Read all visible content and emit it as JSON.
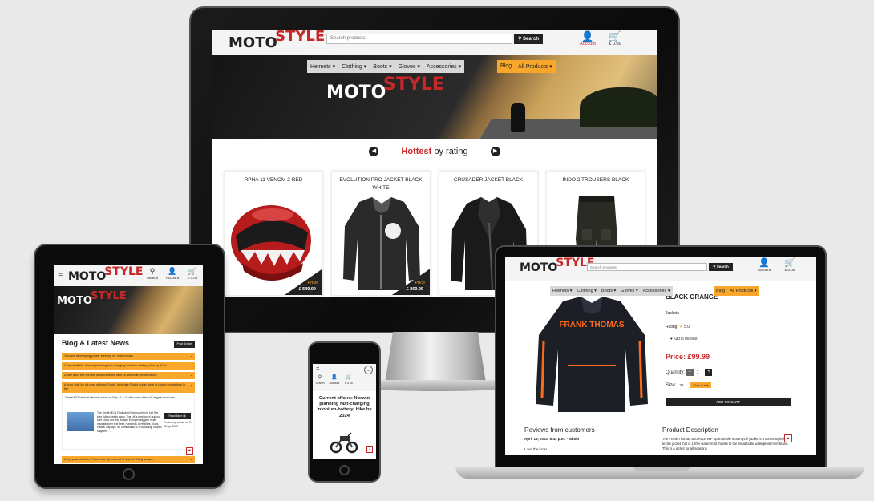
{
  "brand": {
    "moto": "MOTO",
    "style": "STYLE"
  },
  "monitor": {
    "search_placeholder": "Search products",
    "search_button": "Search",
    "account_label": "Account",
    "cart_total": "£ 0.00",
    "nav": [
      "Helmets ▾",
      "Clothing ▾",
      "Boots ▾",
      "Gloves ▾",
      "Accessories ▾"
    ],
    "nav_orange": [
      "Blog",
      "All Products ▾"
    ],
    "hottest_word": "Hottest",
    "hottest_rest": " by rating",
    "products": [
      {
        "name": "RPHA 11 VENOM 2 RED",
        "price_label": "Price",
        "price": "£ 549.99"
      },
      {
        "name": "EVOLUTION PRO JACKET BLACK WHITE",
        "price_label": "Price",
        "price": "£ 269.99"
      },
      {
        "name": "CRUSADER JACKET BLACK",
        "price_label": "",
        "price": ""
      },
      {
        "name": "INDO 2 TROUSERS BLACK",
        "price_label": "",
        "price": ""
      }
    ]
  },
  "tablet": {
    "search_label": "Search",
    "account_label": "Account",
    "cart_total": "£ 0.00",
    "blog_title": "Blog & Latest News",
    "post_button": "Post Article",
    "news": [
      "Yamaha developing power steering for motorcycles",
      "Current affairs: Norwin planning fast-charging 'niobium-battery' bike by 2024",
      "Dollar ditch the chrome to become the face of American performance",
      "A busy shift for off-road officers: South Yorkshire Police out in force to tackle motorbikes in the",
      "Keep yourself safe: Police offer tips ahead of start of riding season"
    ],
    "expanded_lead": "Desert MCN festival files into action on May 14 & 15 with some of the UK biggest stunt acts",
    "expanded_text": "The Devitt MCN Festival of Motorcycling is just five bike riding weeks away. The UK's best loved outdoor bike show not only boasts Europe's biggest multi-manufacturer test fleet, hundreds of retailers, clubs, classic displays; an unmissable, DTRA racing, Moped Mayhem ...",
    "read_more": "Read More ▤",
    "posted_meta": "Posted by: admin on Fri 22 Apr 2022"
  },
  "phone": {
    "search_label": "Search",
    "account_label": "Account",
    "cart_total": "£ 0.00",
    "article_title": "Current affairs: Norwin planning fast-charging 'niobium-battery' bike by 2024"
  },
  "laptop": {
    "search_placeholder": "Search products",
    "search_button": "Search",
    "account_label": "Account",
    "cart_total": "£ 0.00",
    "nav": [
      "Helmets ▾",
      "Clothing ▾",
      "Boots ▾",
      "Gloves ▾",
      "Accessories ▾"
    ],
    "nav_orange": [
      "Blog",
      "All Products ▾"
    ],
    "product_name": "BLACK ORANGE",
    "category": "Jackets",
    "rating_label": "Rating:",
    "rating_value": "5.0",
    "wishlist": "Add to Wishlist",
    "price": "Price: £99.99",
    "quantity_label": "Quantity:",
    "quantity_value": "1",
    "size_label": "Size:",
    "size_value": "38",
    "size_guide": "Size Guide",
    "add_to_cart": "ADD TO CART",
    "jacket_print": "FRANK THOMAS",
    "reviews_title": "Reviews from customers",
    "review_date": "April 19, 2022, 8:43 p.m. - admin",
    "review_text": "Love the look!",
    "description_title": "Product Description",
    "description_text": "The Frank Thomas Evo Race WP Sport textile motorcycle jacket is a sports-styled textile jacket that is 100% waterproof thanks to the breathable waterproof membrane. This is a jacket for all seasons"
  },
  "colors": {
    "accent": "#f9a72a",
    "brand_red": "#c62828",
    "dark": "#222222"
  }
}
